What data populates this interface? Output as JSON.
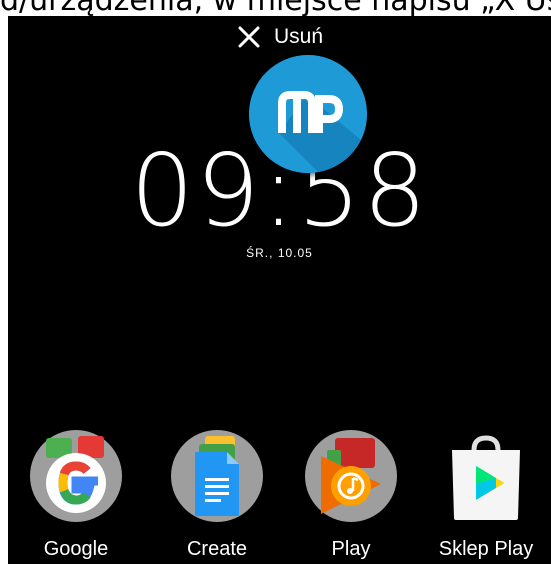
{
  "caption": {
    "text": "d/urządzenia, w miejsce napisu „X Usuń”"
  },
  "remove_target": {
    "icon": "close-icon",
    "label": "Usuń"
  },
  "dragged_app": {
    "icon": "mp-app-icon",
    "color": "#1e9ad6"
  },
  "clock": {
    "time": "09:58",
    "date": "ŚR., 10.05"
  },
  "dock": {
    "apps": [
      {
        "label": "Google",
        "icon": "google-folder-icon"
      },
      {
        "label": "Create",
        "icon": "create-folder-icon"
      },
      {
        "label": "Play",
        "icon": "play-folder-icon"
      },
      {
        "label": "Sklep Play",
        "icon": "play-store-icon"
      }
    ]
  }
}
